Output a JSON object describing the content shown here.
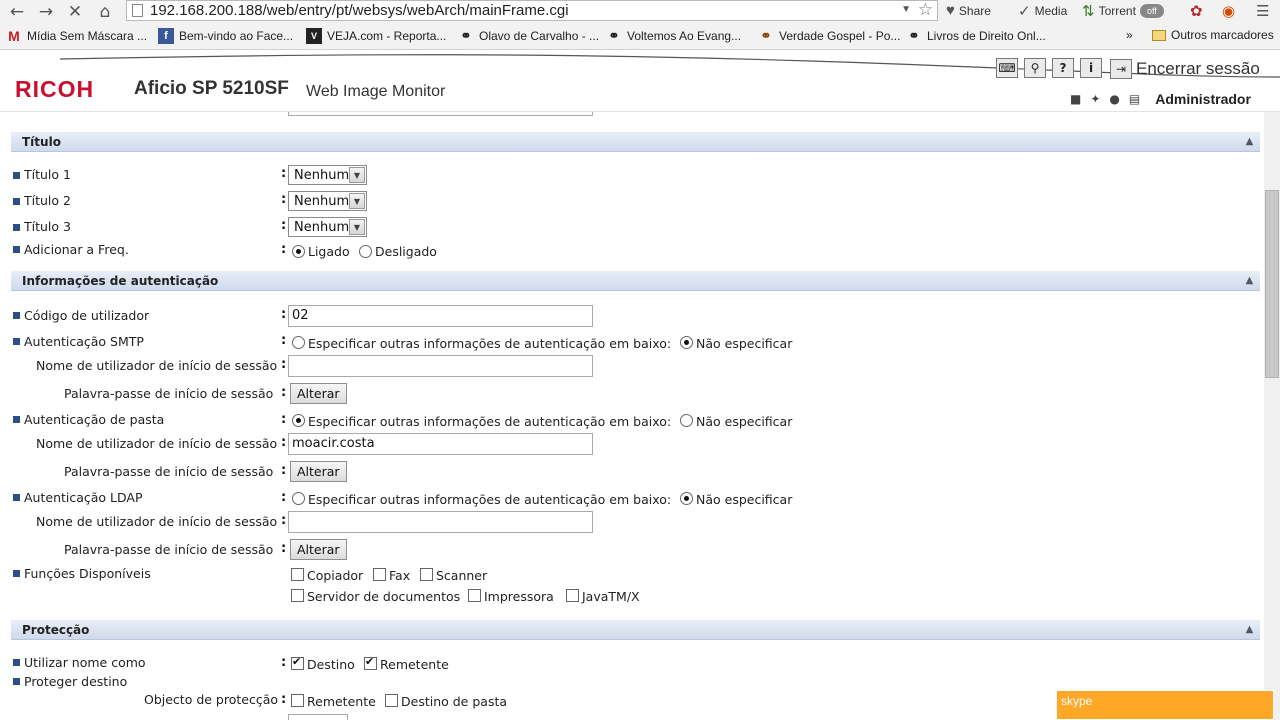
{
  "browser": {
    "url": "192.168.200.188/web/entry/pt/websys/webArch/mainFrame.cgi",
    "extensions": {
      "share_label": "Share",
      "media_label": "Media",
      "torrent_label": "Torrent",
      "torrent_state": "off"
    },
    "bookmarks": [
      {
        "label": "Mídia Sem Máscara ...",
        "icon": "M"
      },
      {
        "label": "Bem-vindo ao Face...",
        "icon": "f"
      },
      {
        "label": "VEJA.com - Reporta...",
        "icon": "V"
      },
      {
        "label": "Olavo de Carvalho - ...",
        "icon": "globe"
      },
      {
        "label": "Voltemos Ao Evang...",
        "icon": "globe"
      },
      {
        "label": "Verdade Gospel - Po...",
        "icon": "globe"
      },
      {
        "label": "Livros de Direito Onl...",
        "icon": "globe"
      }
    ],
    "bookmarks_overflow": "»",
    "other_bookmarks": "Outros marcadores"
  },
  "header": {
    "logo": "RICOH",
    "model": "Aficio SP 5210SF",
    "app_name": "Web Image Monitor",
    "logout": "Encerrar sessão",
    "user": "Administrador"
  },
  "sections": {
    "titulo": {
      "title": "Título",
      "rows": [
        {
          "label": "Título 1",
          "value": "Nenhum"
        },
        {
          "label": "Título 2",
          "value": "Nenhum"
        },
        {
          "label": "Título 3",
          "value": "Nenhum"
        }
      ],
      "freq": {
        "label": "Adicionar a Freq.",
        "on": "Ligado",
        "off": "Desligado"
      }
    },
    "auth": {
      "title": "Informações de autenticação",
      "user_code": {
        "label": "Código de utilizador",
        "value": "02"
      },
      "specify_other": "Especificar outras informações de autenticação em baixo:",
      "do_not_specify": "Não especificar",
      "login_user": "Nome de utilizador de início de sessão",
      "login_password": "Palavra-passe de início de sessão",
      "change_button": "Alterar",
      "smtp": {
        "label": "Autenticação SMTP",
        "user_value": ""
      },
      "folder": {
        "label": "Autenticação de pasta",
        "user_value": "moacir.costa"
      },
      "ldap": {
        "label": "Autenticação LDAP",
        "user_value": ""
      },
      "functions": {
        "label": "Funções Disponíveis",
        "options": [
          "Copiador",
          "Fax",
          "Scanner",
          "Servidor de documentos",
          "Impressora",
          "JavaTM/X"
        ]
      }
    },
    "protection": {
      "title": "Protecção",
      "use_name_as": {
        "label": "Utilizar nome como",
        "dest": "Destino",
        "sender": "Remetente"
      },
      "protect_dest": {
        "label": "Proteger destino"
      },
      "object": {
        "label": "Objecto de protecção",
        "sender": "Remetente",
        "folder_dest": "Destino de pasta"
      }
    }
  },
  "skype": {
    "label": "skype"
  }
}
